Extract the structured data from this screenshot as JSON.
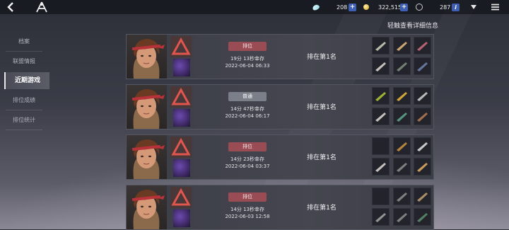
{
  "topbar": {
    "gems": "208",
    "gold": "322,515",
    "tickets": "287",
    "icons": [
      "back-icon",
      "logo-icon",
      "gem-icon",
      "plus-icon",
      "gold-coin-icon",
      "plus-icon",
      "ticket-icon",
      "info-icon",
      "dropdown-icon",
      "menu-icon"
    ]
  },
  "sidebar": {
    "items": [
      {
        "label": "档案",
        "active": false
      },
      {
        "label": "联盟情报",
        "active": false
      },
      {
        "label": "近期游戏",
        "active": true
      },
      {
        "label": "排位成绩",
        "active": false
      },
      {
        "label": "排位统计",
        "active": false
      }
    ]
  },
  "hint": "轻触查看详细信息",
  "colors": {
    "ranked": "#9a4c55",
    "normal": "#7a7f89",
    "accent_blue": "#3e5fb4"
  },
  "matches": [
    {
      "mode": "排位",
      "type": "ranked",
      "duration": "19分 13秒幸存",
      "date": "2022-06-04 06:33",
      "rank": "排在第1名"
    },
    {
      "mode": "普通",
      "type": "normal",
      "duration": "14分 47秒幸存",
      "date": "2022-06-04 06:17",
      "rank": "排在第1名"
    },
    {
      "mode": "排位",
      "type": "ranked",
      "duration": "14分 23秒幸存",
      "date": "2022-06-04 03:37",
      "rank": "排在第1名"
    },
    {
      "mode": "排位",
      "type": "ranked",
      "duration": "14分 13秒幸存",
      "date": "2022-06-03 12:58",
      "rank": "排在第1名"
    }
  ]
}
